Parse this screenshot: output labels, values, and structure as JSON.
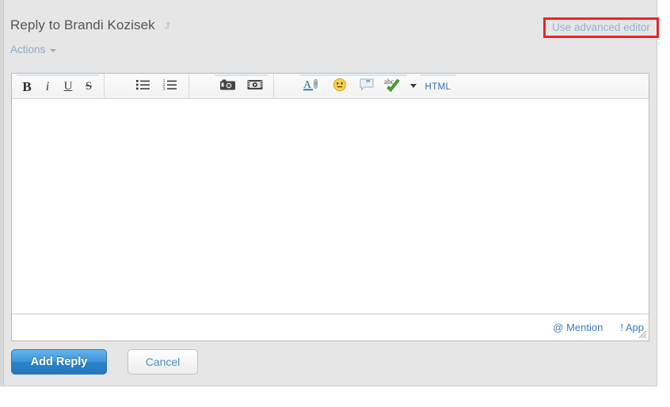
{
  "header": {
    "title": "Reply to Brandi Kozisek",
    "flag_icon": "share-arrow-icon",
    "actions_label": "Actions",
    "advanced_editor_label": "Use advanced editor",
    "highlight_color": "#ed2326",
    "link_color": "#93b0cf"
  },
  "toolbar": {
    "groups": [
      {
        "name": "text-format",
        "buttons": [
          {
            "name": "bold-icon",
            "label": "B"
          },
          {
            "name": "italic-icon",
            "label": "i"
          },
          {
            "name": "underline-icon",
            "label": "U"
          },
          {
            "name": "strikethrough-icon",
            "label": "S"
          }
        ]
      },
      {
        "name": "lists",
        "buttons": [
          {
            "name": "bullet-list-icon",
            "label": ""
          },
          {
            "name": "numbered-list-icon",
            "label": ""
          }
        ]
      },
      {
        "name": "media",
        "buttons": [
          {
            "name": "insert-image-icon",
            "label": ""
          },
          {
            "name": "insert-video-icon",
            "label": ""
          }
        ]
      },
      {
        "name": "extras",
        "buttons": [
          {
            "name": "font-color-icon",
            "label": "A"
          },
          {
            "name": "emoticon-icon",
            "label": ""
          },
          {
            "name": "quote-icon",
            "label": ""
          },
          {
            "name": "spellcheck-icon",
            "label": "abc"
          },
          {
            "name": "html-source-button",
            "label": "HTML"
          }
        ]
      }
    ]
  },
  "compose": {
    "value": "",
    "placeholder": ""
  },
  "editor_footer": {
    "mention_label": "@ Mention",
    "app_label": "! App",
    "resize_handle": "resize-grip-icon",
    "link_color": "#3a7bc8"
  },
  "buttons": {
    "submit_label": "Add Reply",
    "cancel_label": "Cancel",
    "submit_color": "#2a84ca",
    "cancel_text_color": "#4c8ecb"
  }
}
